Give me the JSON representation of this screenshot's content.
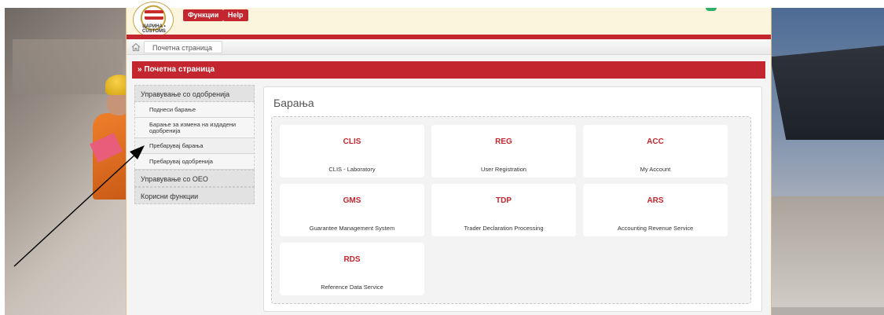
{
  "header": {
    "logo_text": "ЦАРИНА • CUSTOMS",
    "buttons": [
      {
        "label": "Функции"
      },
      {
        "label": "Help"
      }
    ]
  },
  "breadcrumb": {
    "items": [
      {
        "label": "Почетна страница"
      }
    ]
  },
  "page": {
    "title": "» Почетна страница"
  },
  "sidebar": {
    "groups": [
      {
        "label": "Управување со одобренија",
        "items": [
          {
            "label": "Поднеси барање"
          },
          {
            "label": "Барање за измена на издадени одобренија"
          },
          {
            "label": "Пребарувај барања"
          },
          {
            "label": "Пребарувај одобренија"
          }
        ]
      },
      {
        "label": "Управување со OEO"
      },
      {
        "label": "Корисни функции"
      }
    ]
  },
  "content": {
    "title": "Барања",
    "tiles": [
      {
        "code": "CLIS",
        "name": "CLIS - Laboratory"
      },
      {
        "code": "REG",
        "name": "User Registration"
      },
      {
        "code": "ACC",
        "name": "My Account"
      },
      {
        "code": "GMS",
        "name": "Guarantee Management System"
      },
      {
        "code": "TDP",
        "name": "Trader Declaration Processing"
      },
      {
        "code": "ARS",
        "name": "Accounting Revenue Service"
      },
      {
        "code": "RDS",
        "name": "Reference Data Service"
      }
    ]
  },
  "colors": {
    "accent": "#c3262f",
    "header_bg": "#fbf5de",
    "panel_bg": "#f4f4f4"
  },
  "icons": {
    "home": "home-icon"
  }
}
